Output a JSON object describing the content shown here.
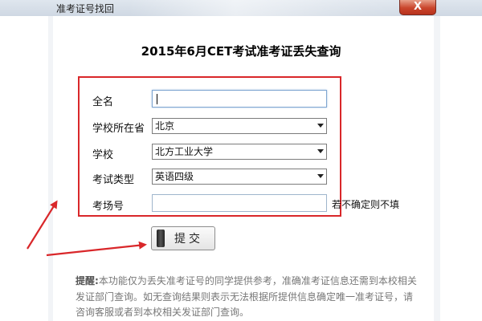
{
  "window": {
    "title": "准考证号找回",
    "close_label": "X"
  },
  "heading": "2015年6月CET考试准考证丢失查询",
  "form": {
    "fullname": {
      "label": "全名",
      "value": ""
    },
    "province": {
      "label": "学校所在省",
      "selected": "北京"
    },
    "school": {
      "label": "学校",
      "selected": "北方工业大学"
    },
    "exam_type": {
      "label": "考试类型",
      "selected": "英语四级"
    },
    "room": {
      "label": "考场号",
      "value": "",
      "hint": "若不确定则不填"
    }
  },
  "submit_label": "提交",
  "notice": {
    "label": "提醒:",
    "text": "本功能仅为丢失准考证号的同学提供参考，准确准考证信息还需到本校相关发证部门查询。如无查询结果则表示无法根据所提供信息确定唯一准考证号，请咨询客服或者到本校相关发证部门查询。"
  },
  "colors": {
    "highlight_box": "#d9272a",
    "arrow": "#d9272a",
    "notice_text": "#777777"
  }
}
